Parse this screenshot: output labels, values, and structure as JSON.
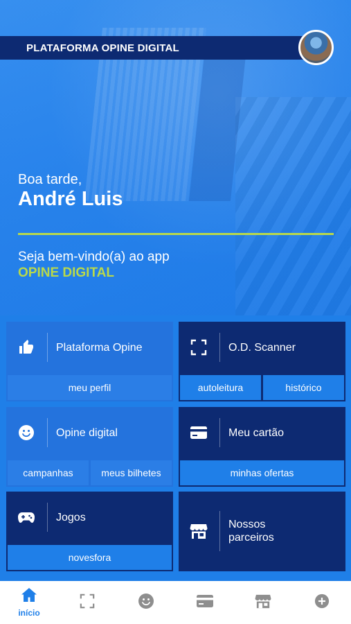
{
  "header": {
    "title": "PLATAFORMA OPINE DIGITAL"
  },
  "greeting": {
    "salutation": "Boa tarde,",
    "name": "André Luis"
  },
  "welcome": {
    "text": "Seja bem-vindo(a) ao app",
    "brand": "OPINE DIGITAL"
  },
  "cards": [
    {
      "label": "Plataforma Opine",
      "icon": "thumbs-up-icon",
      "actions": [
        "meu perfil"
      ]
    },
    {
      "label": "O.D. Scanner",
      "icon": "scan-icon",
      "actions": [
        "autoleitura",
        "histórico"
      ]
    },
    {
      "label": "Opine digital",
      "icon": "smiley-icon",
      "actions": [
        "campanhas",
        "meus bilhetes"
      ]
    },
    {
      "label": "Meu cartão",
      "icon": "credit-card-icon",
      "actions": [
        "minhas ofertas"
      ]
    },
    {
      "label": "Jogos",
      "icon": "gamepad-icon",
      "actions": [
        "novesfora"
      ]
    },
    {
      "label": "Nossos parceiros",
      "icon": "store-icon",
      "actions": []
    }
  ],
  "nav": {
    "items": [
      {
        "label": "início",
        "icon": "home-icon",
        "active": true
      },
      {
        "label": "",
        "icon": "scan-icon"
      },
      {
        "label": "",
        "icon": "smiley-icon"
      },
      {
        "label": "",
        "icon": "credit-card-icon"
      },
      {
        "label": "",
        "icon": "store-icon"
      },
      {
        "label": "",
        "icon": "plus-circle-icon"
      }
    ]
  },
  "colors": {
    "primary": "#1f7fe8",
    "dark": "#0d2a72",
    "accent": "#b9d94a"
  }
}
